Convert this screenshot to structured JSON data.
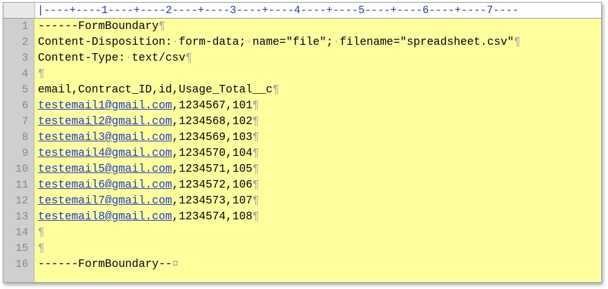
{
  "ruler": {
    "text": "|----+----1----+----2----+----3----+----4----+----5----+----6----+----7----"
  },
  "colors": {
    "background": "#ffff9e",
    "gutter": "#cfcfcf",
    "link": "#1a3cd0",
    "ruler_text": "#1e3fb0",
    "whitespace_marker": "#a8a8a8"
  },
  "symbols": {
    "pilcrow": "¶",
    "space_dot": "·",
    "eof_marker": "¤"
  },
  "lines": [
    {
      "num": "1",
      "text": "------FormBoundary"
    },
    {
      "num": "2",
      "parts": [
        "Content-Disposition:",
        "form-data;",
        "name=\"file\";",
        "filename=\"spreadsheet.csv\""
      ]
    },
    {
      "num": "3",
      "parts": [
        "Content-Type:",
        "text/csv"
      ]
    },
    {
      "num": "4",
      "text": ""
    },
    {
      "num": "5",
      "text": "email,Contract_ID,id,Usage_Total__c"
    },
    {
      "num": "6",
      "email": "testemail1@gmail.com",
      "rest": ",1234567,101"
    },
    {
      "num": "7",
      "email": "testemail2@gmail.com",
      "rest": ",1234568,102"
    },
    {
      "num": "8",
      "email": "testemail3@gmail.com",
      "rest": ",1234569,103"
    },
    {
      "num": "9",
      "email": "testemail4@gmail.com",
      "rest": ",1234570,104"
    },
    {
      "num": "10",
      "email": "testemail5@gmail.com",
      "rest": ",1234571,105"
    },
    {
      "num": "11",
      "email": "testemail6@gmail.com",
      "rest": ",1234572,106"
    },
    {
      "num": "12",
      "email": "testemail7@gmail.com",
      "rest": ",1234573,107"
    },
    {
      "num": "13",
      "email": "testemail8@gmail.com",
      "rest": ",1234574,108"
    },
    {
      "num": "14",
      "text": ""
    },
    {
      "num": "15",
      "text": ""
    },
    {
      "num": "16",
      "text": "------FormBoundary--"
    }
  ]
}
